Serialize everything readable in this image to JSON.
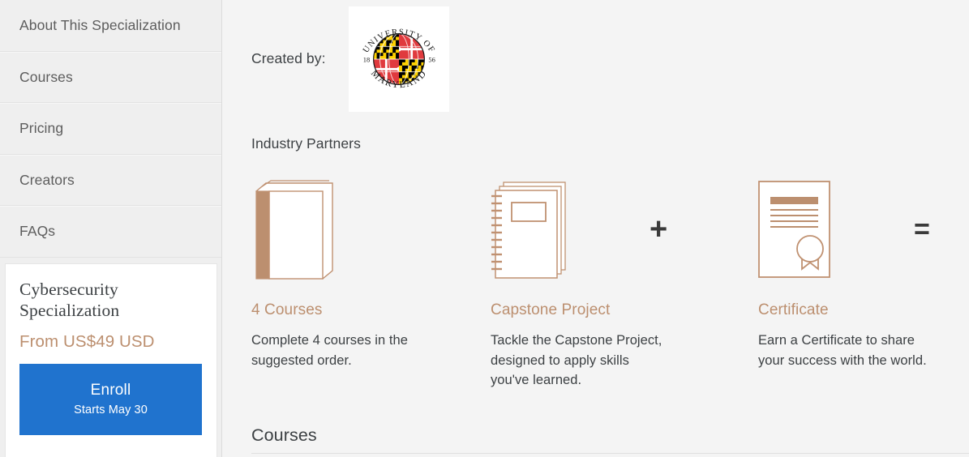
{
  "sidebar": {
    "nav_items": [
      {
        "label": "About This Specialization",
        "name": "about-this-specialization"
      },
      {
        "label": "Courses",
        "name": "courses"
      },
      {
        "label": "Pricing",
        "name": "pricing"
      },
      {
        "label": "Creators",
        "name": "creators"
      },
      {
        "label": "FAQs",
        "name": "faqs"
      }
    ],
    "promo": {
      "title": "Cybersecurity Specialization",
      "price": "From US$49 USD",
      "enroll_label": "Enroll",
      "enroll_sub": "Starts May 30"
    }
  },
  "main": {
    "created_by_label": "Created by:",
    "logo": {
      "name": "university-of-maryland-seal",
      "top_text": "UNIVERSITY OF",
      "bottom_text": "MARYLAND",
      "year_left": "18",
      "year_right": "56"
    },
    "industry_partners_label": "Industry Partners",
    "operators": {
      "plus": "+",
      "equals": "="
    },
    "tiles": [
      {
        "icon": "book-icon",
        "heading": "4 Courses",
        "description": "Complete 4 courses in the suggested order."
      },
      {
        "icon": "notebook-icon",
        "heading": "Capstone Project",
        "description": "Tackle the Capstone Project, designed to apply skills you've learned."
      },
      {
        "icon": "certificate-icon",
        "heading": "Certificate",
        "description": "Earn a Certificate to share your success with the world."
      }
    ],
    "courses_heading": "Courses"
  },
  "colors": {
    "accent_tan": "#bc8f6f",
    "enroll_blue": "#2073ce",
    "sidebar_bg": "#efefef",
    "main_bg": "#f4f4f4",
    "text": "#3c4043",
    "umd_red": "#e03a3e",
    "umd_gold": "#ffd200",
    "umd_black": "#000000"
  }
}
